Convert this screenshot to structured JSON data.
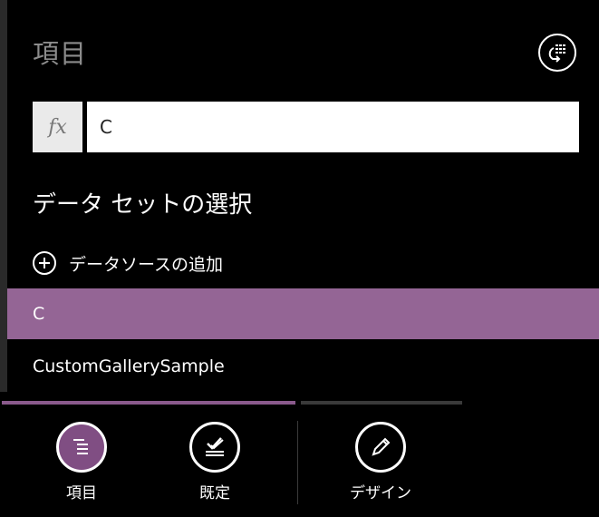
{
  "header": {
    "title": "項目",
    "sync_icon": "refresh-list-icon"
  },
  "formula_bar": {
    "fx_label": "fx",
    "value": "C"
  },
  "data_source": {
    "heading": "データ セットの選択",
    "add_label": "データソースの追加",
    "items": [
      {
        "label": "C",
        "selected": true
      },
      {
        "label": "CustomGallerySample",
        "selected": false
      }
    ]
  },
  "bottom_tabs": [
    {
      "label": "項目",
      "icon": "items-icon",
      "active": true
    },
    {
      "label": "既定",
      "icon": "default-icon",
      "active": false
    },
    {
      "label": "デザイン",
      "icon": "pencil-icon",
      "active": false
    }
  ],
  "colors": {
    "accent": "#946595",
    "accent_dark": "#804e83",
    "background": "#000000",
    "scroll_active": "#8a5a8c",
    "scroll_track": "#3a3a3a"
  }
}
